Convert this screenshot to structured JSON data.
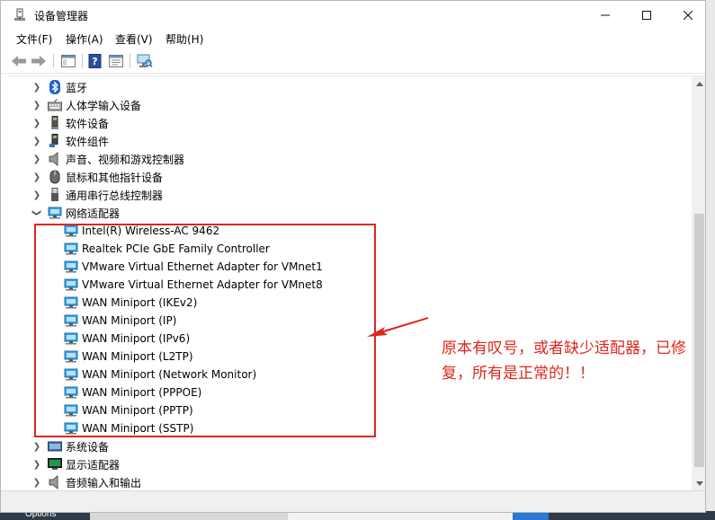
{
  "window": {
    "title": "设备管理器",
    "controls": {
      "minimize": "—",
      "maximize": "☐",
      "close": "✕"
    }
  },
  "menubar": [
    {
      "label": "文件(F)"
    },
    {
      "label": "操作(A)"
    },
    {
      "label": "查看(V)"
    },
    {
      "label": "帮助(H)"
    }
  ],
  "tree": {
    "categories_before": [
      {
        "label": "蓝牙",
        "icon": "bluetooth-icon",
        "expanded": false
      },
      {
        "label": "人体学输入设备",
        "icon": "hid-icon",
        "expanded": false
      },
      {
        "label": "软件设备",
        "icon": "software-device-icon",
        "expanded": false
      },
      {
        "label": "软件组件",
        "icon": "software-component-icon",
        "expanded": false
      },
      {
        "label": "声音、视频和游戏控制器",
        "icon": "speaker-icon",
        "expanded": false
      },
      {
        "label": "鼠标和其他指针设备",
        "icon": "mouse-icon",
        "expanded": false
      },
      {
        "label": "通用串行总线控制器",
        "icon": "usb-icon",
        "expanded": false
      }
    ],
    "network": {
      "label": "网络适配器",
      "icon": "network-adapter-icon",
      "expanded": true,
      "devices": [
        {
          "label": "Intel(R) Wireless-AC 9462"
        },
        {
          "label": "Realtek PCIe GbE Family Controller"
        },
        {
          "label": "VMware Virtual Ethernet Adapter for VMnet1"
        },
        {
          "label": "VMware Virtual Ethernet Adapter for VMnet8"
        },
        {
          "label": "WAN Miniport (IKEv2)"
        },
        {
          "label": "WAN Miniport (IP)"
        },
        {
          "label": "WAN Miniport (IPv6)"
        },
        {
          "label": "WAN Miniport (L2TP)"
        },
        {
          "label": "WAN Miniport (Network Monitor)"
        },
        {
          "label": "WAN Miniport (PPPOE)"
        },
        {
          "label": "WAN Miniport (PPTP)"
        },
        {
          "label": "WAN Miniport (SSTP)"
        }
      ]
    },
    "categories_after": [
      {
        "label": "系统设备",
        "icon": "system-device-icon",
        "expanded": false
      },
      {
        "label": "显示适配器",
        "icon": "display-adapter-icon",
        "expanded": false
      },
      {
        "label": "音频输入和输出",
        "icon": "audio-io-icon",
        "expanded": false
      }
    ]
  },
  "annotation": {
    "text": "原本有叹号，或者缺少适配器，已修复，所有是正常的！！",
    "color": "#e0261c"
  },
  "background": {
    "taskbar_label": "Options"
  },
  "colors": {
    "accent_red": "#e0261c",
    "network_icon_blue": "#1c8fd6"
  }
}
